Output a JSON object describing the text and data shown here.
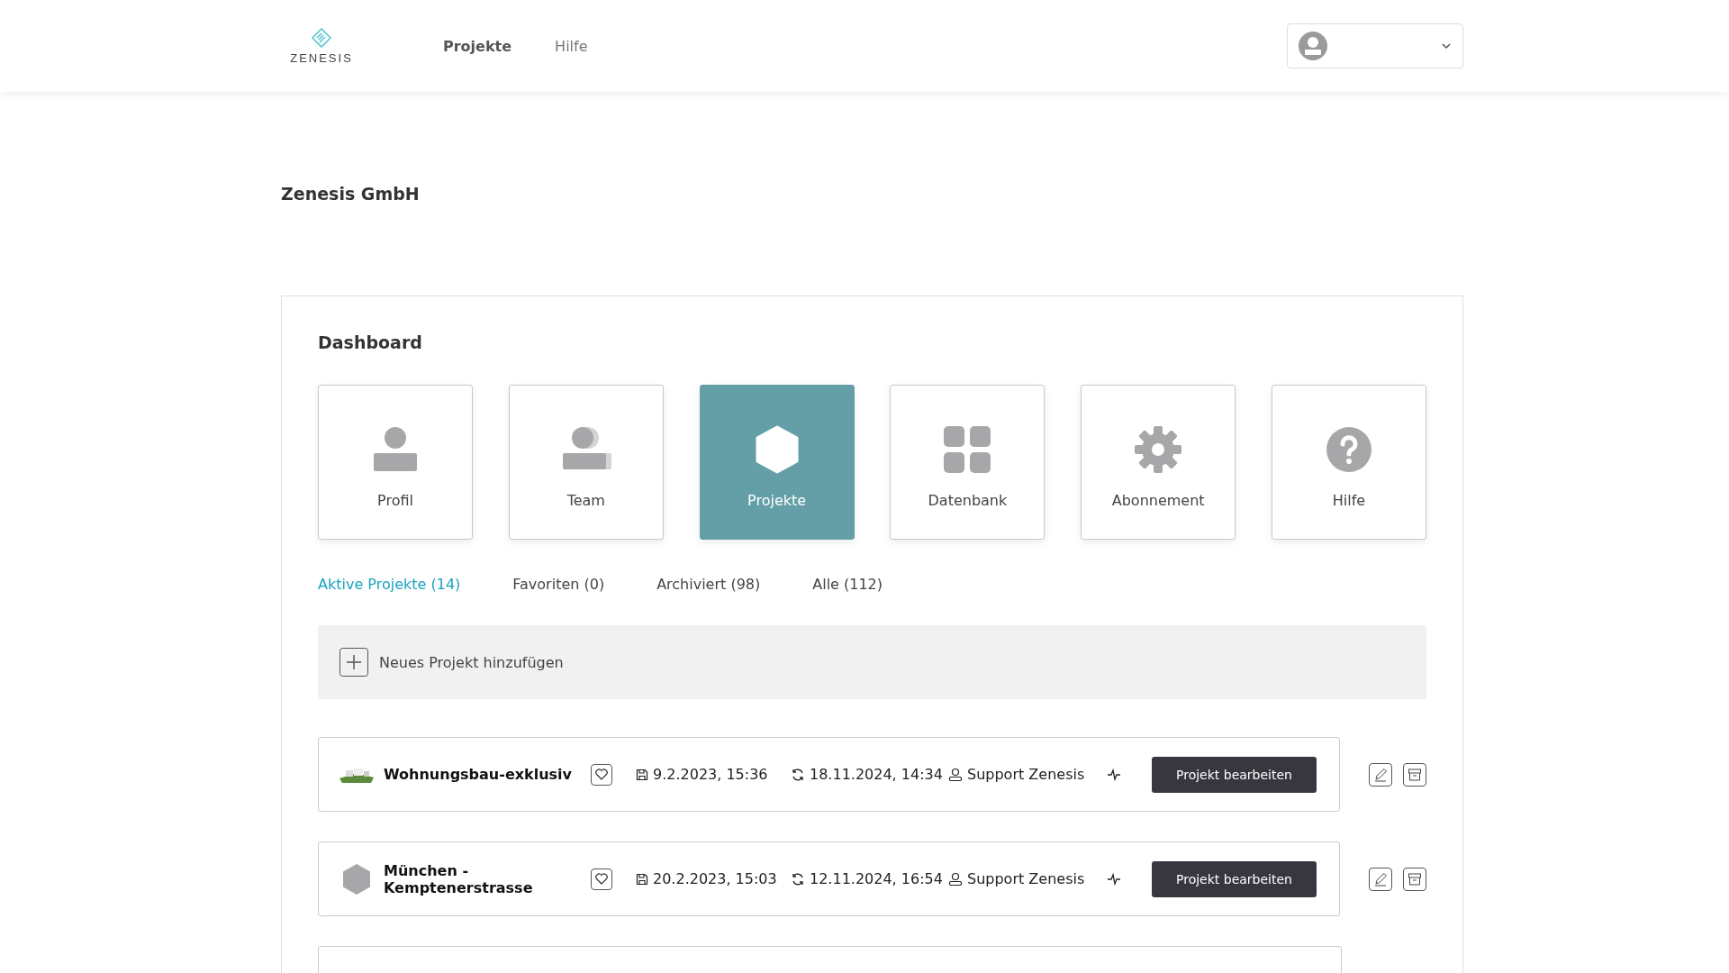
{
  "header": {
    "logo": "ZENESIS",
    "nav": [
      {
        "label": "Projekte",
        "selected": true
      },
      {
        "label": "Hilfe",
        "selected": false
      }
    ]
  },
  "company": "Zenesis GmbH",
  "dashboard": {
    "title": "Dashboard",
    "tiles": [
      {
        "kind": "profile",
        "label": "Profil",
        "selected": false
      },
      {
        "kind": "team",
        "label": "Team",
        "selected": false
      },
      {
        "kind": "projects",
        "label": "Projekte",
        "selected": true
      },
      {
        "kind": "database",
        "label": "Datenbank",
        "selected": false
      },
      {
        "kind": "subscription",
        "label": "Abonnement",
        "selected": false
      },
      {
        "kind": "help",
        "label": "Hilfe",
        "selected": false
      }
    ],
    "filters": [
      {
        "label": "Aktive Projekte (14)",
        "selected": true
      },
      {
        "label": "Favoriten (0)",
        "selected": false
      },
      {
        "label": "Archiviert (98)",
        "selected": false
      },
      {
        "label": "Alle (112)",
        "selected": false
      }
    ],
    "add_project": "Neues Projekt hinzufügen",
    "projects": [
      {
        "kind": "photo",
        "name": "Wohnungsbau-exklusiv",
        "saved": "9.2.2023, 15:36",
        "synced": "18.11.2024, 14:34",
        "owner": "Support Zenesis",
        "button": "Projekt bearbeiten"
      },
      {
        "kind": "hexagon",
        "name": "München - Kemptenerstrasse",
        "saved": "20.2.2023, 15:03",
        "synced": "12.11.2024, 16:54",
        "owner": "Support Zenesis",
        "button": "Projekt bearbeiten"
      }
    ]
  }
}
